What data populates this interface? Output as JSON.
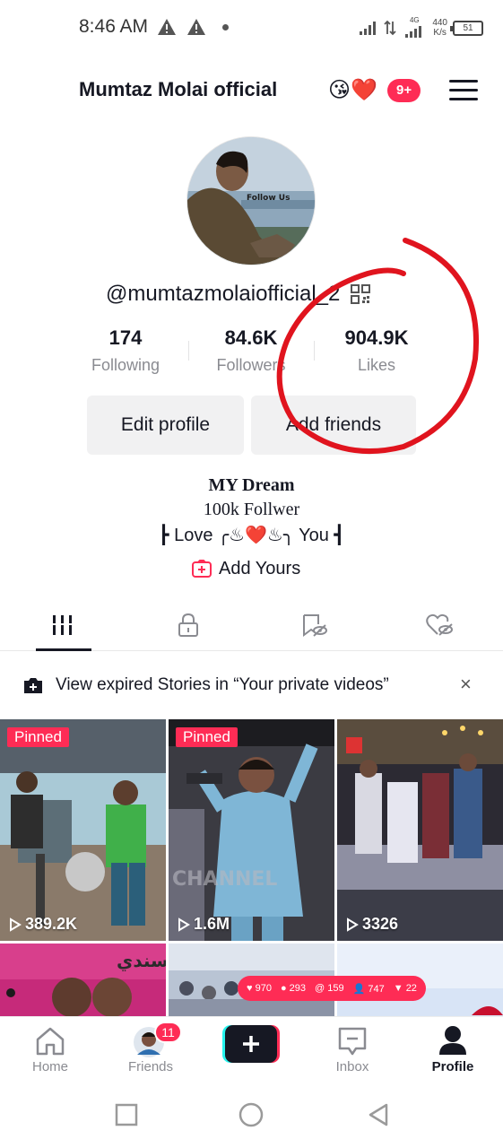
{
  "status_bar": {
    "time": "8:46 AM",
    "network_speed_value": "440",
    "network_speed_unit": "K/s",
    "network_type": "4G",
    "battery": "51"
  },
  "header": {
    "title": "Mumtaz Molai official",
    "title_emoji": "😘❤️",
    "notification_badge": "9+"
  },
  "profile": {
    "username": "@mumtazmolaiofficial_2",
    "avatar_caption": "Follow Us",
    "stats": [
      {
        "value": "174",
        "label": "Following"
      },
      {
        "value": "84.6K",
        "label": "Followers"
      },
      {
        "value": "904.9K",
        "label": "Likes"
      }
    ],
    "buttons": {
      "edit_profile": "Edit profile",
      "add_friends": "Add friends"
    },
    "bio": {
      "line1": "MY Dream",
      "line2": "100k Follwer",
      "line3": "┣ Love ╭♨❤️♨╮ You ┫"
    },
    "add_yours": "Add Yours"
  },
  "tabs": [
    {
      "icon": "grid-icon",
      "active": true
    },
    {
      "icon": "lock-icon",
      "active": false
    },
    {
      "icon": "favorites-icon",
      "active": false
    },
    {
      "icon": "liked-icon",
      "active": false
    }
  ],
  "stories_banner": {
    "text": "View expired Stories in “Your private videos”",
    "close": "×"
  },
  "videos": [
    {
      "pinned_label": "Pinned",
      "views": "389.2K"
    },
    {
      "pinned_label": "Pinned",
      "views": "1.6M",
      "watermark": "CHANNEL"
    },
    {
      "views": "3326"
    },
    {
      "partial_text": "سندي"
    },
    {},
    {}
  ],
  "overlay_stats": {
    "hearts": "970",
    "comments": "293",
    "mentions": "159",
    "followers": "747",
    "gifts": "22"
  },
  "bottom_nav": {
    "home": "Home",
    "friends": "Friends",
    "friends_badge": "11",
    "inbox": "Inbox",
    "profile": "Profile"
  },
  "colors": {
    "accent": "#fe2c55",
    "text": "#161823",
    "secondary_text": "#8a8b91",
    "button_bg": "#f1f1f2",
    "annotation_red": "#e0141e"
  }
}
